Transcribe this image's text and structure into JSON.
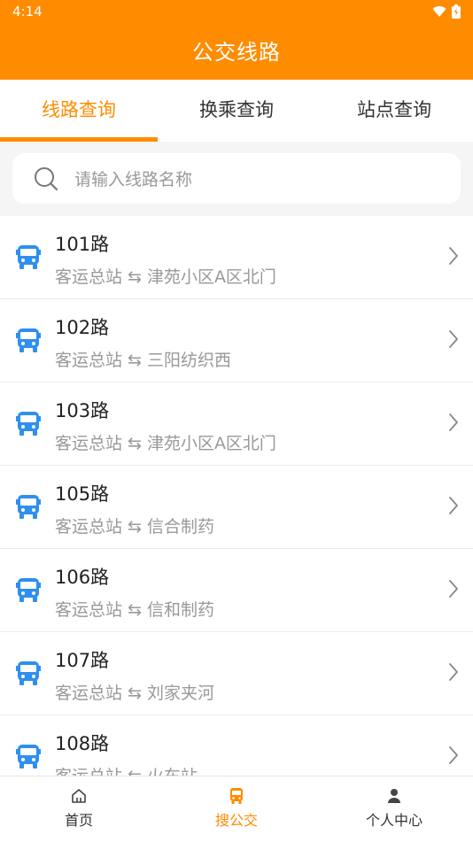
{
  "status": {
    "time": "4:14"
  },
  "header": {
    "title": "公交线路"
  },
  "tabs": [
    {
      "label": "线路查询",
      "active": true
    },
    {
      "label": "换乘查询",
      "active": false
    },
    {
      "label": "站点查询",
      "active": false
    }
  ],
  "search": {
    "placeholder": "请输入线路名称",
    "value": ""
  },
  "routes": [
    {
      "name": "101路",
      "from": "客运总站",
      "to": "津苑小区A区北门"
    },
    {
      "name": "102路",
      "from": "客运总站",
      "to": "三阳纺织西"
    },
    {
      "name": "103路",
      "from": "客运总站",
      "to": "津苑小区A区北门"
    },
    {
      "name": "105路",
      "from": "客运总站",
      "to": "信合制药"
    },
    {
      "name": "106路",
      "from": "客运总站",
      "to": "信和制药"
    },
    {
      "name": "107路",
      "from": "客运总站",
      "to": "刘家夹河"
    },
    {
      "name": "108路",
      "from": "客运总站",
      "to": "火车站"
    }
  ],
  "swap_symbol": "⇆",
  "bottom_nav": [
    {
      "label": "首页",
      "icon": "home-icon",
      "active": false
    },
    {
      "label": "搜公交",
      "icon": "bus-icon",
      "active": true
    },
    {
      "label": "个人中心",
      "icon": "person-icon",
      "active": false
    }
  ],
  "colors": {
    "accent": "#ff8c00",
    "bus_icon": "#2e8ff0",
    "muted": "#999999"
  }
}
